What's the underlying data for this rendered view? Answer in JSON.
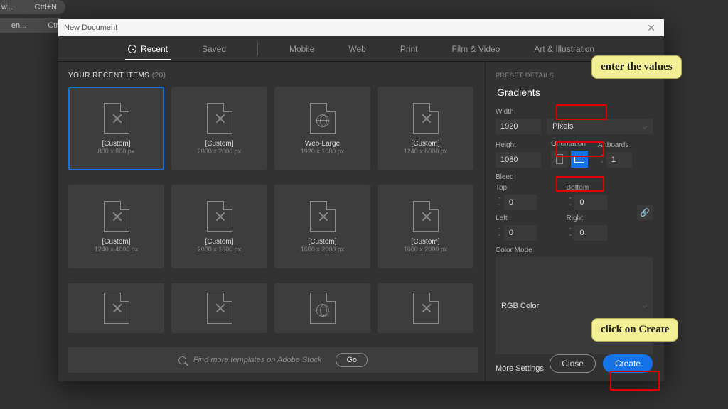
{
  "bgMenu": {
    "item1_shortcut": "Ctrl+N",
    "item1_suffix": "w...",
    "item2_shortcut": "Ctr",
    "item2_suffix": "en..."
  },
  "titlebar": {
    "title": "New Document",
    "close": "✕"
  },
  "tabs": {
    "recent": "Recent",
    "saved": "Saved",
    "mobile": "Mobile",
    "web": "Web",
    "print": "Print",
    "film": "Film & Video",
    "art": "Art & Illustration"
  },
  "section": {
    "title": "YOUR RECENT ITEMS",
    "count": "(20)"
  },
  "cards": [
    {
      "name": "[Custom]",
      "dims": "800 x 800 px",
      "icon": "x",
      "selected": true
    },
    {
      "name": "[Custom]",
      "dims": "2000 x 2000 px",
      "icon": "x"
    },
    {
      "name": "Web-Large",
      "dims": "1920 x 1080 px",
      "icon": "globe"
    },
    {
      "name": "[Custom]",
      "dims": "1240 x 6000 px",
      "icon": "x"
    },
    {
      "name": "[Custom]",
      "dims": "1240 x 4000 px",
      "icon": "x"
    },
    {
      "name": "[Custom]",
      "dims": "2000 x 1600 px",
      "icon": "x"
    },
    {
      "name": "[Custom]",
      "dims": "1600 x 2000 px",
      "icon": "x"
    },
    {
      "name": "[Custom]",
      "dims": "1600 x 2000 px",
      "icon": "x"
    }
  ],
  "row3icons": [
    "x",
    "x",
    "globe",
    "x"
  ],
  "search": {
    "placeholder": "Find more templates on Adobe Stock",
    "go": "Go"
  },
  "preset": {
    "head": "PRESET DETAILS",
    "name": "Gradients",
    "width_label": "Width",
    "width": "1920",
    "units": "Pixels",
    "height_label": "Height",
    "height": "1080",
    "orientation_label": "Orientation",
    "artboards_label": "Artboards",
    "artboards": "1",
    "bleed_label": "Bleed",
    "top_label": "Top",
    "top": "0",
    "bottom_label": "Bottom",
    "bottom": "0",
    "left_label": "Left",
    "left": "0",
    "right_label": "Right",
    "right": "0",
    "colormode_label": "Color Mode",
    "colormode": "RGB Color",
    "more": "More Settings"
  },
  "footer": {
    "close": "Close",
    "create": "Create"
  },
  "callouts": {
    "top": "enter the values",
    "bottom": "click on Create"
  },
  "colors": {
    "accent": "#1473e6",
    "annotation": "#e00000",
    "callout": "#f2ee93"
  }
}
